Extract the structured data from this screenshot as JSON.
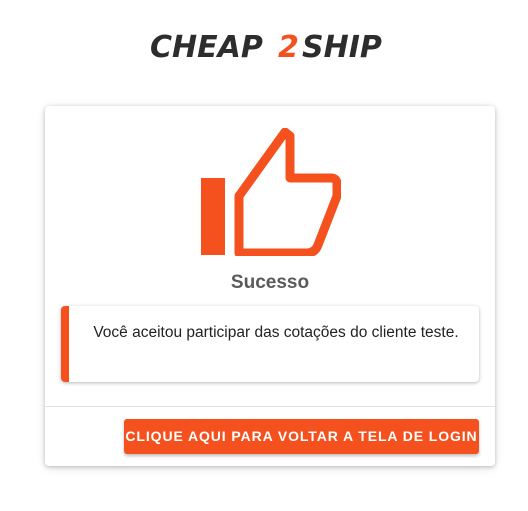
{
  "brand": {
    "logo_text_left": "CHEAP",
    "logo_text_mid": "2",
    "logo_text_right": "SHIP",
    "logo_dark_color": "#2d2d2d",
    "logo_accent_color": "#f4511e"
  },
  "card": {
    "icon": "thumbs-up-icon",
    "icon_color": "#f4511e",
    "title": "Sucesso",
    "message": "Você aceitou participar das cotações do cliente teste.",
    "action_label": "CLIQUE AQUI PARA VOLTAR A TELA DE LOGIN"
  },
  "colors": {
    "accent": "#f4511e",
    "title_text": "#5a5a5a",
    "body_text": "#222222"
  }
}
